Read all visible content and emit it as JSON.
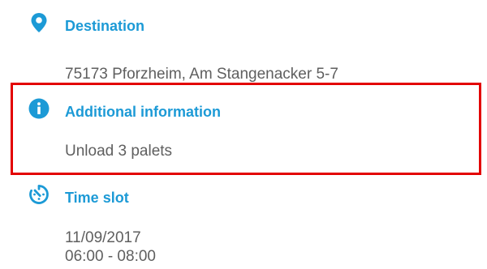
{
  "destination": {
    "icon": "map-pin-icon",
    "heading": "Destination",
    "value": "75173 Pforzheim, Am Stangenacker 5-7"
  },
  "additional_information": {
    "icon": "info-icon",
    "heading": "Additional information",
    "value": "Unload 3 palets"
  },
  "time_slot": {
    "icon": "timer-icon",
    "heading": "Time slot",
    "date": "11/09/2017",
    "time_range": "06:00 - 08:00"
  },
  "colors": {
    "accent": "#1c9ad6",
    "text": "#5f5f5f",
    "highlight": "#e30000"
  }
}
